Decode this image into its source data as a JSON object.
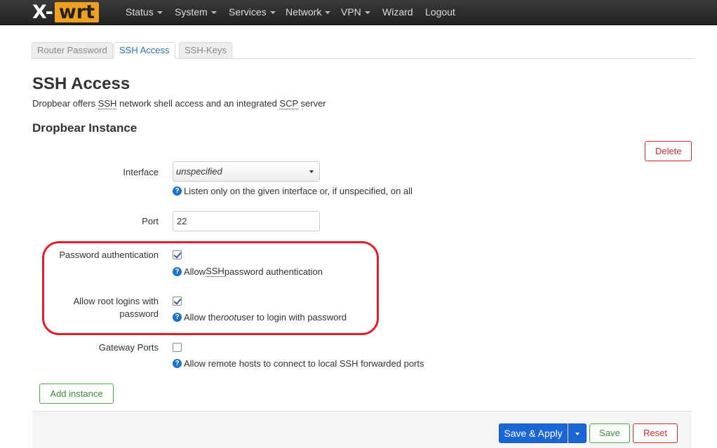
{
  "nav": {
    "logo_part1": "X-",
    "logo_part2": "wrt",
    "items": [
      {
        "label": "Status",
        "dropdown": true
      },
      {
        "label": "System",
        "dropdown": true
      },
      {
        "label": "Services",
        "dropdown": true
      },
      {
        "label": "Network",
        "dropdown": true
      },
      {
        "label": "VPN",
        "dropdown": true
      },
      {
        "label": "Wizard",
        "dropdown": false
      },
      {
        "label": "Logout",
        "dropdown": false
      }
    ]
  },
  "tabs": [
    {
      "label": "Router Password",
      "active": false
    },
    {
      "label": "SSH Access",
      "active": true
    },
    {
      "label": "SSH-Keys",
      "active": false
    }
  ],
  "page": {
    "title": "SSH Access",
    "desc_pre": "Dropbear offers ",
    "desc_abbr1": "SSH",
    "desc_mid": " network shell access and an integrated ",
    "desc_abbr2": "SCP",
    "desc_post": " server",
    "section_title": "Dropbear Instance",
    "delete_label": "Delete"
  },
  "form": {
    "interface": {
      "label": "Interface",
      "value": "unspecified",
      "hint": "Listen only on the given interface or, if unspecified, on all"
    },
    "port": {
      "label": "Port",
      "value": "22"
    },
    "password_auth": {
      "label": "Password authentication",
      "checked": true,
      "hint_pre": "Allow ",
      "hint_abbr": "SSH",
      "hint_post": " password authentication"
    },
    "root_login": {
      "label_line1": "Allow root logins with",
      "label_line2": "password",
      "checked": true,
      "hint_pre": "Allow the ",
      "hint_em": "root",
      "hint_post": " user to login with password"
    },
    "gateway_ports": {
      "label": "Gateway Ports",
      "checked": false,
      "hint": "Allow remote hosts to connect to local SSH forwarded ports"
    }
  },
  "actions": {
    "add_instance": "Add instance",
    "save_apply": "Save & Apply",
    "save": "Save",
    "reset": "Reset"
  },
  "colors": {
    "navbar": "#2b2b2b",
    "logo_accent": "#f0a020",
    "primary": "#1a66d6",
    "success": "#4cae4c",
    "danger": "#c9302c",
    "highlight": "#e0202a"
  },
  "icons": {
    "help": "question-circle-icon",
    "dropdown": "caret-down-icon",
    "check": "checkmark-icon"
  }
}
